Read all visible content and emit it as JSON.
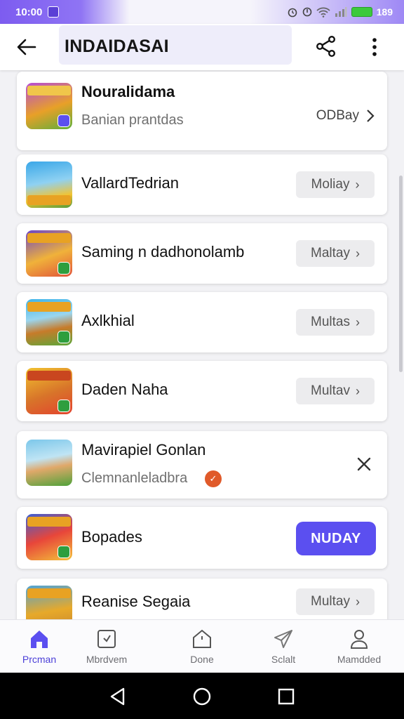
{
  "status_bar": {
    "time": "10:00",
    "battery": "189"
  },
  "app_bar": {
    "title": "INDAIDASAI"
  },
  "items": [
    {
      "title": "Nouralidama",
      "subtitle": "Banian prantdas",
      "action": "ODBay",
      "action_type": "text",
      "thumb": {
        "c1": "#b54bd6",
        "c2": "#e8a028",
        "c3": "#5fae3b",
        "badge": "#5b4ff0"
      }
    },
    {
      "title": "VallardTedrian",
      "subtitle": "",
      "action": "Moliay",
      "action_type": "pill",
      "thumb": {
        "c1": "#3aa7e8",
        "c2": "#f2c331",
        "c3": "#4f9a3a",
        "badge": "#e8a223"
      }
    },
    {
      "title": "Saming n dadhonolamb",
      "subtitle": "",
      "action": "Maltay",
      "action_type": "pill",
      "thumb": {
        "c1": "#6b45c8",
        "c2": "#f0b23a",
        "c3": "#e0543a",
        "badge": "#2e9e3e"
      }
    },
    {
      "title": "Axlkhial",
      "subtitle": "",
      "action": "Multas",
      "action_type": "pill",
      "thumb": {
        "c1": "#3eb4ea",
        "c2": "#c77b2a",
        "c3": "#5aa83a",
        "badge": "#2e9e3e"
      }
    },
    {
      "title": "Daden Naha",
      "subtitle": "",
      "action": "Multav",
      "action_type": "pill",
      "thumb": {
        "c1": "#f1c02e",
        "c2": "#d8742a",
        "c3": "#e2442e",
        "badge": "#2e9e3e"
      }
    },
    {
      "title": "Mavirapiel Gonlan",
      "subtitle": "Clemnanleladbra",
      "action": "",
      "action_type": "close",
      "thumb": {
        "c1": "#7cc7ea",
        "c2": "#e0a86a",
        "c3": "#4fa23a",
        "badge": ""
      }
    },
    {
      "title": "Bopades",
      "subtitle": "",
      "action": "NUDAY",
      "action_type": "primary",
      "thumb": {
        "c1": "#3a5fd6",
        "c2": "#e8463a",
        "c3": "#f3c23a",
        "badge": "#2e9e3e"
      }
    },
    {
      "title": "Reanise Segaia",
      "subtitle": "",
      "action": "Multay",
      "action_type": "pill",
      "thumb": {
        "c1": "#4fa3d6",
        "c2": "#e7a92a",
        "c3": "#c6852e",
        "badge": ""
      }
    }
  ],
  "bottom_nav": [
    {
      "label": "Prcman",
      "icon": "home-icon",
      "active": true
    },
    {
      "label": "Mbrdvem",
      "icon": "inbox-icon",
      "active": false
    },
    {
      "label": "Done",
      "icon": "home-outline-icon",
      "active": false
    },
    {
      "label": "Sclalt",
      "icon": "send-icon",
      "active": false
    },
    {
      "label": "Mamdded",
      "icon": "person-icon",
      "active": false
    }
  ],
  "colors": {
    "accent": "#5b4ff0",
    "status_gradient": "#7d5cf0"
  }
}
